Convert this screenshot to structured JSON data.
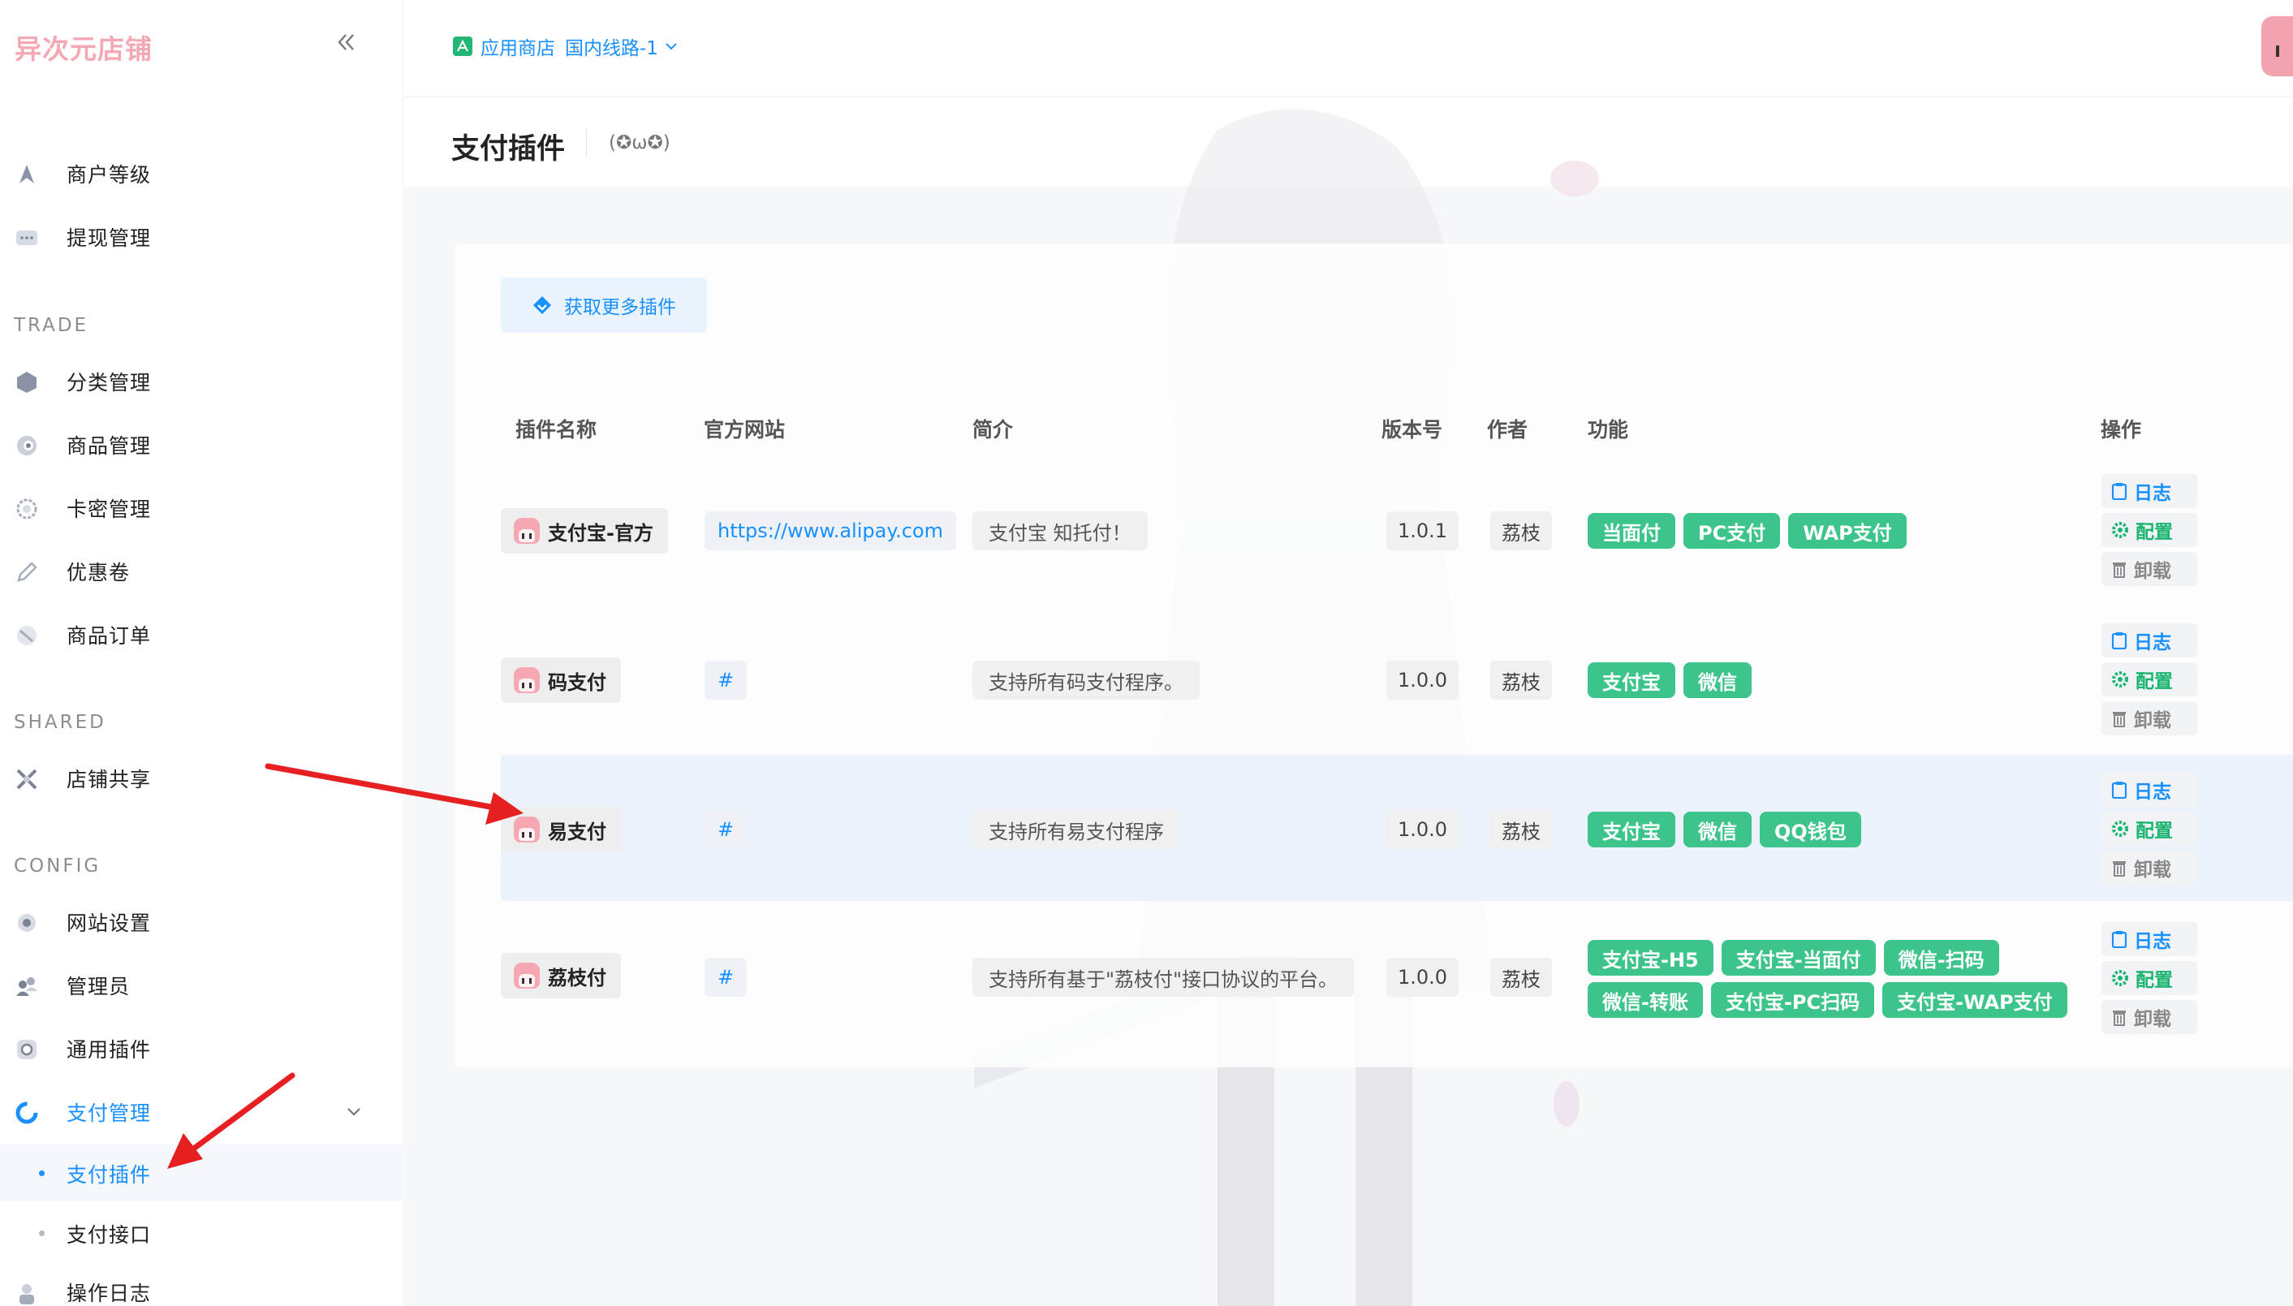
{
  "brand": {
    "logo": "异次元店铺"
  },
  "sidebar": {
    "items_top": [
      {
        "label": "商户等级",
        "icon": "star-icon"
      },
      {
        "label": "提现管理",
        "icon": "dots-icon"
      }
    ],
    "section_trade": "TRADE",
    "items_trade": [
      {
        "label": "分类管理",
        "icon": "cube-icon"
      },
      {
        "label": "商品管理",
        "icon": "product-icon"
      },
      {
        "label": "卡密管理",
        "icon": "gear-icon"
      },
      {
        "label": "优惠卷",
        "icon": "pencil-icon"
      },
      {
        "label": "商品订单",
        "icon": "order-icon"
      }
    ],
    "section_shared": "SHARED",
    "items_shared": [
      {
        "label": "店铺共享",
        "icon": "share-icon"
      }
    ],
    "section_config": "CONFIG",
    "items_config": [
      {
        "label": "网站设置",
        "icon": "settings-icon"
      },
      {
        "label": "管理员",
        "icon": "users-icon"
      },
      {
        "label": "通用插件",
        "icon": "plugin-icon"
      },
      {
        "label": "支付管理",
        "icon": "payment-icon"
      }
    ],
    "pay_sub": [
      {
        "label": "支付插件",
        "selected": true
      },
      {
        "label": "支付接口",
        "selected": false
      }
    ],
    "item_log": {
      "label": "操作日志",
      "icon": "log-icon"
    }
  },
  "topbar": {
    "store_label": "应用商店",
    "route_label": "国内线路-1"
  },
  "page": {
    "title": "支付插件",
    "kaomoji": "(✪ω✪)",
    "more_plugins": "获取更多插件"
  },
  "table": {
    "headers": {
      "name": "插件名称",
      "site": "官方网站",
      "desc": "简介",
      "version": "版本号",
      "author": "作者",
      "features": "功能",
      "actions": "操作"
    },
    "rows": [
      {
        "name": "支付宝-官方",
        "site": "https://www.alipay.com",
        "desc": "支付宝 知托付！",
        "version": "1.0.1",
        "author": "荔枝",
        "features": [
          "当面付",
          "PC支付",
          "WAP支付"
        ]
      },
      {
        "name": "码支付",
        "site": "#",
        "desc": "支持所有码支付程序。",
        "version": "1.0.0",
        "author": "荔枝",
        "features": [
          "支付宝",
          "微信"
        ]
      },
      {
        "name": "易支付",
        "site": "#",
        "desc": "支持所有易支付程序",
        "version": "1.0.0",
        "author": "荔枝",
        "features": [
          "支付宝",
          "微信",
          "QQ钱包"
        ]
      },
      {
        "name": "荔枝付",
        "site": "#",
        "desc": "支持所有基于\"荔枝付\"接口协议的平台。",
        "version": "1.0.0",
        "author": "荔枝",
        "features": [
          "支付宝-H5",
          "支付宝-当面付",
          "微信-扫码",
          "微信-转账",
          "支付宝-PC扫码",
          "支付宝-WAP支付"
        ]
      }
    ],
    "actions": {
      "log": "日志",
      "config": "配置",
      "uninstall": "卸载"
    }
  },
  "colors": {
    "accent": "#1890ff",
    "tag_green": "#3cc48a",
    "logo_pink": "#f4a8b3",
    "arrow_red": "#e62020"
  }
}
